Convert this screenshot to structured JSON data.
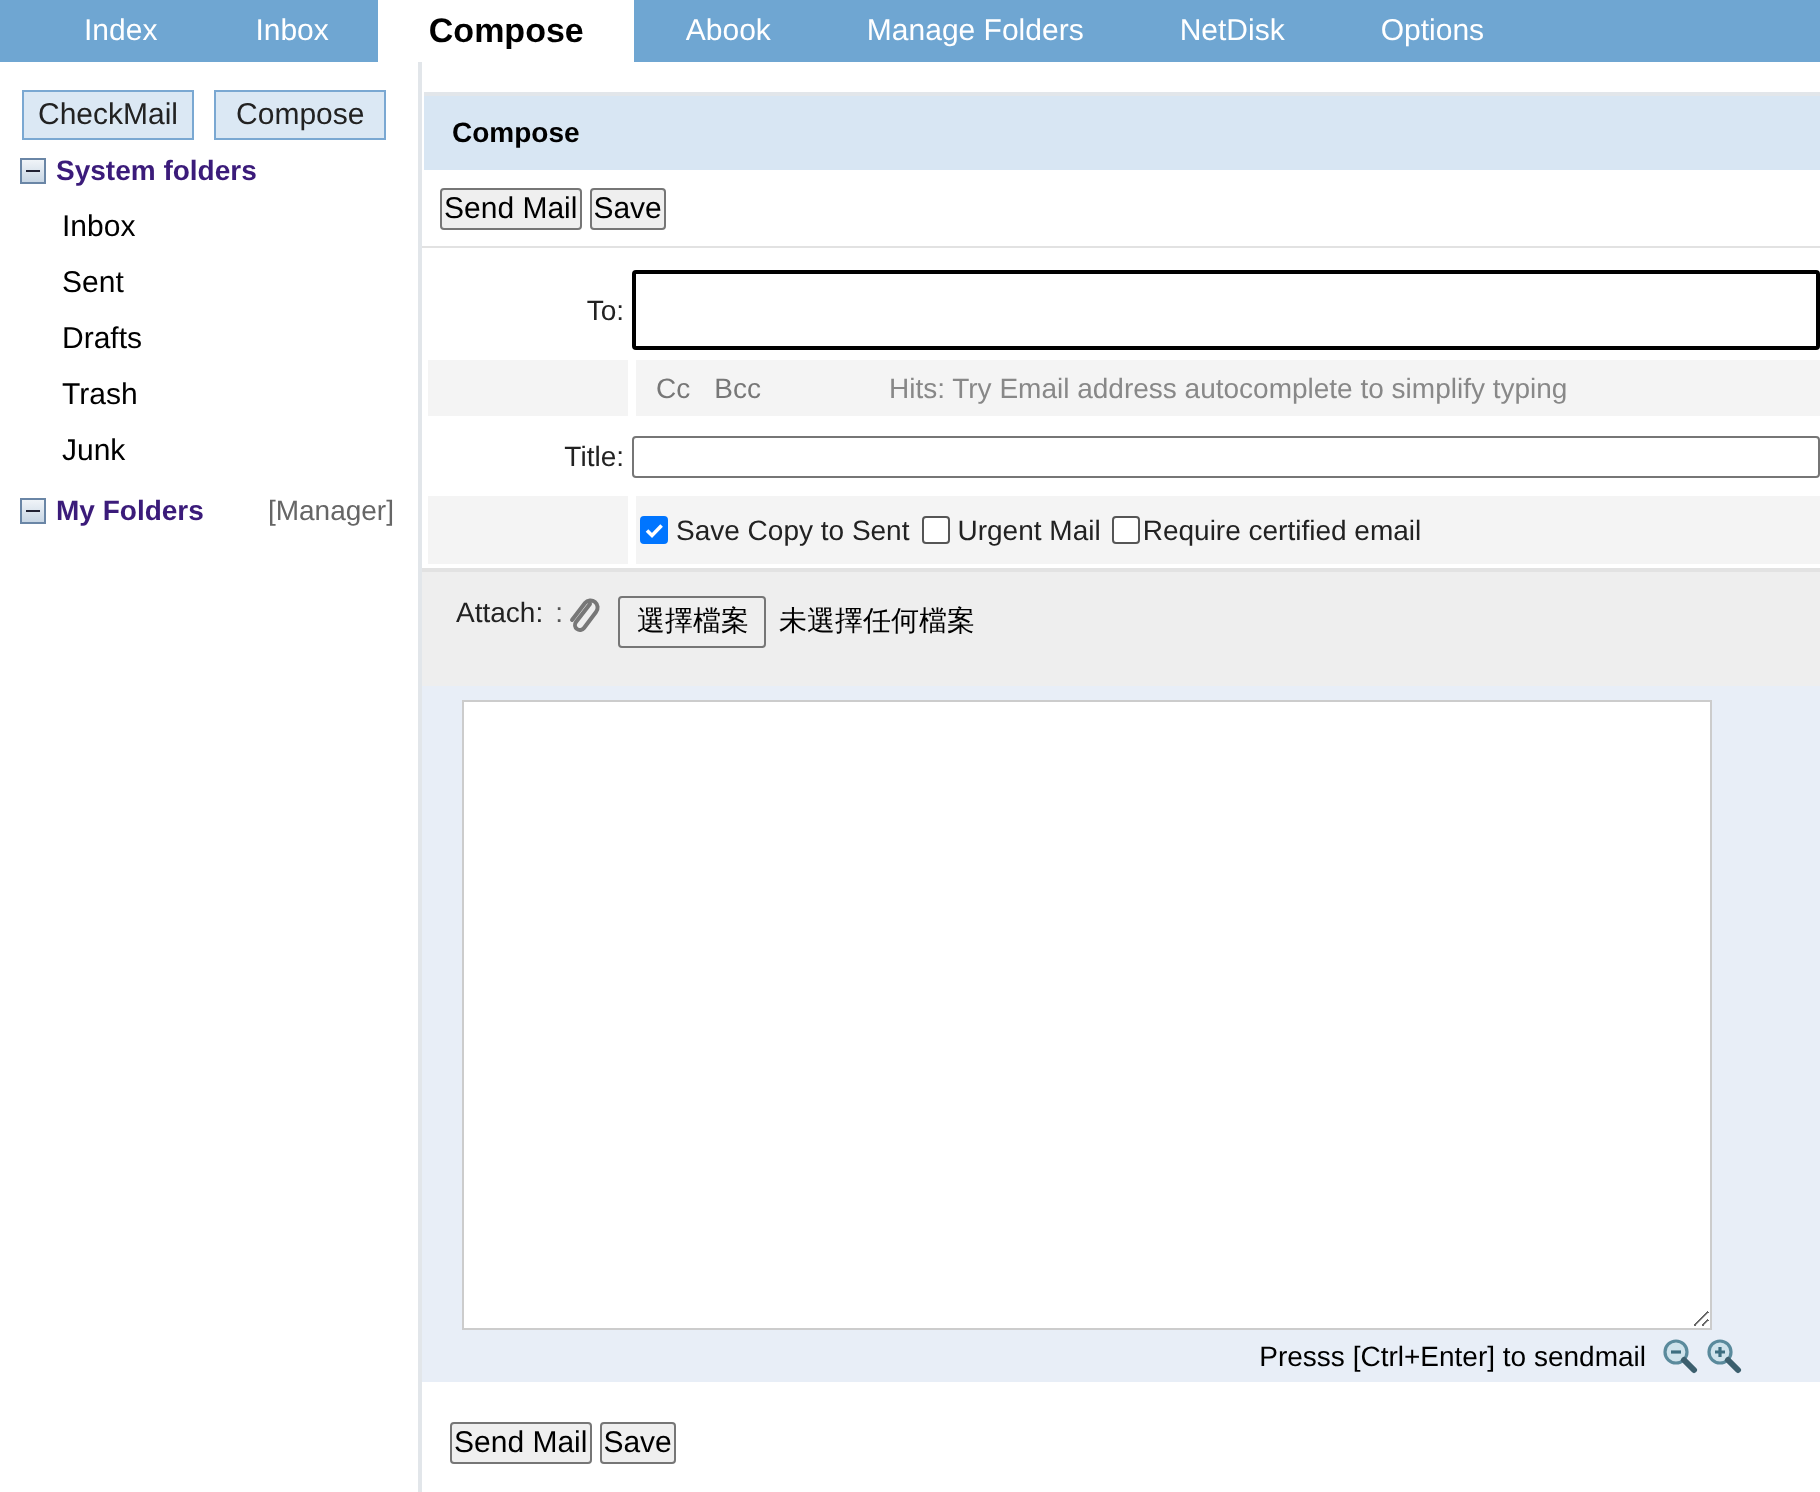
{
  "tabs": [
    {
      "label": "Index",
      "selected": false
    },
    {
      "label": "Inbox",
      "selected": false
    },
    {
      "label": "Compose",
      "selected": true
    },
    {
      "label": "Abook",
      "selected": false
    },
    {
      "label": "Manage Folders",
      "selected": false
    },
    {
      "label": "NetDisk",
      "selected": false
    },
    {
      "label": "Options",
      "selected": false
    }
  ],
  "sidebar": {
    "buttons": [
      "CheckMail",
      "Compose"
    ],
    "groups": [
      {
        "label": "System folders",
        "expanded": true,
        "children": [
          {
            "label": "Inbox"
          },
          {
            "label": "Sent"
          },
          {
            "label": "Drafts"
          },
          {
            "label": "Trash"
          },
          {
            "label": "Junk"
          }
        ]
      },
      {
        "label": "My Folders",
        "expanded": true,
        "link": "[Manager]"
      }
    ]
  },
  "compose": {
    "title": "Compose",
    "top_buttons": [
      "Send Mail",
      "Save"
    ],
    "to_label": "To:",
    "cc": "Cc",
    "bcc": "Bcc",
    "hint": "Hits: Try Email address autocomplete to simplify typing",
    "title_label": "Title:",
    "options": [
      {
        "label": "Save Copy to Sent",
        "checked": true
      },
      {
        "label": "Urgent Mail",
        "checked": false
      },
      {
        "label": "Require certified email",
        "checked": false
      }
    ],
    "attach_label": "Attach:",
    "attach_sep": ":",
    "file_button": "選擇檔案",
    "file_status": "未選擇任何檔案",
    "send_hint": "Presss [Ctrl+Enter] to sendmail",
    "bottom_buttons": [
      "Send Mail",
      "Save"
    ]
  }
}
